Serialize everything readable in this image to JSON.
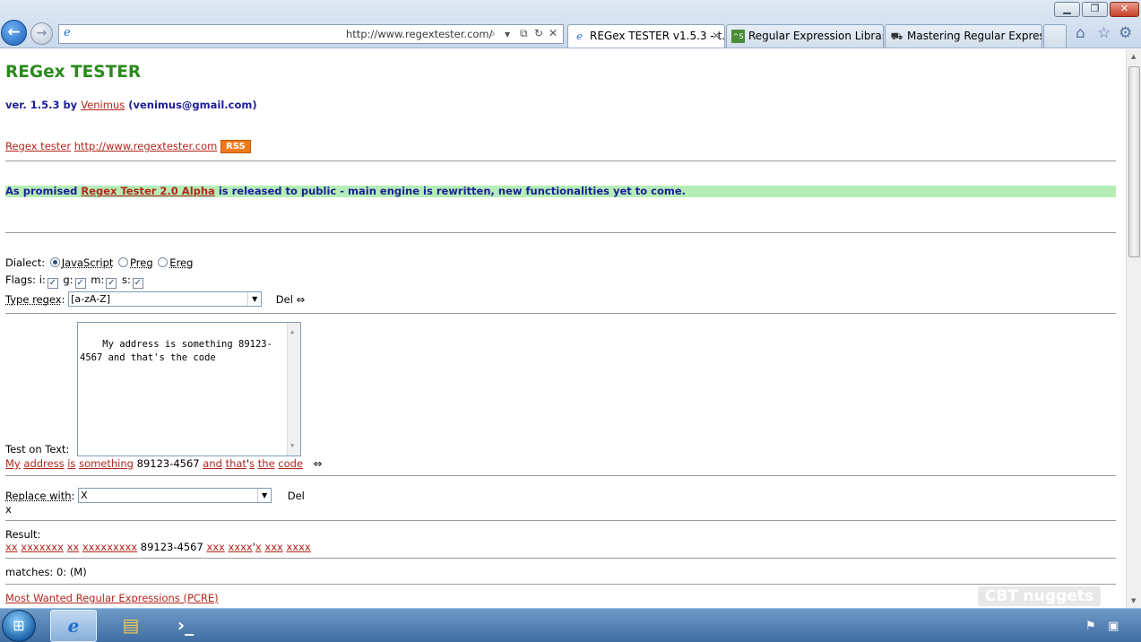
{
  "window": {
    "minimize_icon": "minimize-icon",
    "restore_icon": "restore-icon",
    "close_icon": "close-icon"
  },
  "address_bar": {
    "url": "http://www.regextester.com/"
  },
  "tabs": [
    {
      "label": "REGex TESTER v1.5.3 - t...",
      "icon": "ie-page-icon",
      "active": true
    },
    {
      "label": "Regular Expression Library",
      "icon": "regexlib-icon",
      "active": false
    },
    {
      "label": "Mastering Regular Express...",
      "icon": "oreilly-icon",
      "active": false
    }
  ],
  "page": {
    "title": "REGex TESTER",
    "version_prefix": "ver. 1.5.3 by",
    "author_link": "Venimus",
    "author_email": "(venimus@gmail.com)",
    "site_link_label": "Regex tester",
    "site_link_url": "http://www.regextester.com",
    "rss_label": "RSS",
    "announcement_prefix": "As promised",
    "announcement_link": "Regex Tester 2.0 Alpha",
    "announcement_suffix": "is released to public - main engine is rewritten, new functionalities yet to come.",
    "dialect_label": "Dialect:",
    "dialects": [
      {
        "label": "JavaScript",
        "selected": true
      },
      {
        "label": "Preg",
        "selected": false
      },
      {
        "label": "Ereg",
        "selected": false
      }
    ],
    "flags_label": "Flags:",
    "flags": [
      {
        "label": "i:",
        "checked": true
      },
      {
        "label": "g:",
        "checked": true
      },
      {
        "label": "m:",
        "checked": true
      },
      {
        "label": "s:",
        "checked": true
      }
    ],
    "type_regex_label": "Type regex",
    "regex_value": "[a-zA-Z]",
    "del_label": "Del",
    "swap_icon": "⇔",
    "test_on_text_label": "Test on Text:",
    "test_text": "My address is something 89123-4567 and that's the code",
    "highlight_tokens": [
      {
        "text": "My",
        "match": true
      },
      {
        "text": " ",
        "match": false
      },
      {
        "text": "address",
        "match": true
      },
      {
        "text": " ",
        "match": false
      },
      {
        "text": "is",
        "match": true
      },
      {
        "text": " ",
        "match": false
      },
      {
        "text": "something",
        "match": true
      },
      {
        "text": " 89123-4567 ",
        "match": false
      },
      {
        "text": "and",
        "match": true
      },
      {
        "text": " ",
        "match": false
      },
      {
        "text": "that",
        "match": true
      },
      {
        "text": "'",
        "match": false
      },
      {
        "text": "s",
        "match": true
      },
      {
        "text": " ",
        "match": false
      },
      {
        "text": "the",
        "match": true
      },
      {
        "text": " ",
        "match": false
      },
      {
        "text": "code",
        "match": true
      }
    ],
    "replace_with_label": "Replace with",
    "replace_value": "X",
    "replace_preview": "x",
    "result_label": "Result:",
    "result_tokens": [
      {
        "text": "xx",
        "match": true
      },
      {
        "text": " ",
        "match": false
      },
      {
        "text": "xxxxxxx",
        "match": true
      },
      {
        "text": " ",
        "match": false
      },
      {
        "text": "xx",
        "match": true
      },
      {
        "text": " ",
        "match": false
      },
      {
        "text": "xxxxxxxxx",
        "match": true
      },
      {
        "text": " 89123-4567 ",
        "match": false
      },
      {
        "text": "xxx",
        "match": true
      },
      {
        "text": " ",
        "match": false
      },
      {
        "text": "xxxx",
        "match": true
      },
      {
        "text": "'",
        "match": false
      },
      {
        "text": "x",
        "match": true
      },
      {
        "text": " ",
        "match": false
      },
      {
        "text": "xxx",
        "match": true
      },
      {
        "text": " ",
        "match": false
      },
      {
        "text": "xxxx",
        "match": true
      }
    ],
    "matches_text": "matches: 0: (M)",
    "most_wanted_link": "Most Wanted Regular Expressions (PCRE)",
    "watermark": "CBT nuggets"
  },
  "taskbar": {
    "start_icon": "windows-start-icon",
    "pinned": [
      "internet-explorer-icon",
      "windows-explorer-icon",
      "powershell-icon"
    ],
    "tray": [
      "action-center-flag-icon",
      "network-icon"
    ]
  }
}
